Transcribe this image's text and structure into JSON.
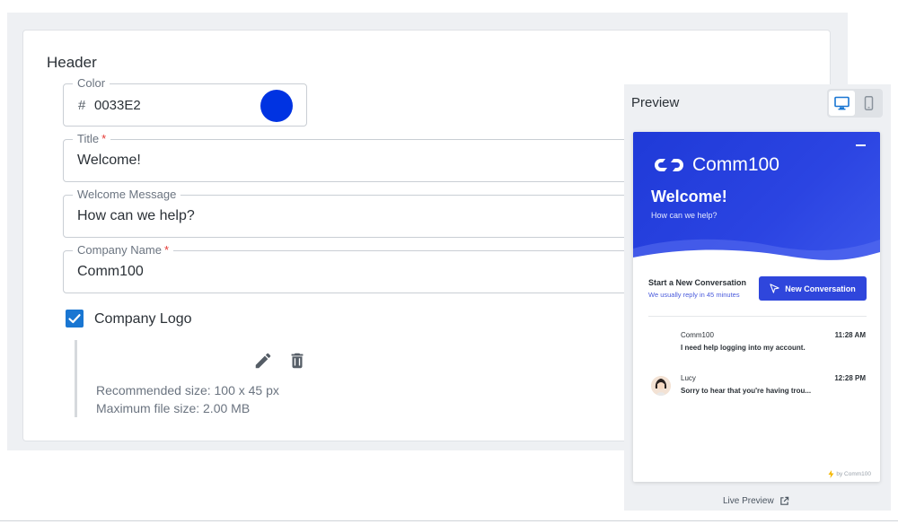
{
  "header": {
    "section_title": "Header"
  },
  "color_field": {
    "label": "Color",
    "hash": "#",
    "value": "0033E2",
    "swatch_color": "#0033E2"
  },
  "title_field": {
    "label": "Title",
    "required_mark": "*",
    "value": "Welcome!"
  },
  "welcome_field": {
    "label": "Welcome Message",
    "value": "How can we help?"
  },
  "company_field": {
    "label": "Company Name",
    "required_mark": "*",
    "value": "Comm100"
  },
  "company_logo": {
    "checkbox_label": "Company Logo",
    "checked": true,
    "edit_icon": "pencil-icon",
    "delete_icon": "trash-icon",
    "recommended": "Recommended size: 100 x 45 px",
    "max_size": "Maximum file size: 2.00 MB"
  },
  "preview": {
    "title": "Preview",
    "devices": [
      "desktop-icon",
      "mobile-icon"
    ],
    "selected_device": "desktop",
    "live_preview_label": "Live Preview",
    "widget": {
      "brand": "Comm100",
      "title": "Welcome!",
      "subtitle": "How can we help?",
      "start_title": "Start a New Conversation",
      "start_sub": "We usually reply in 45 minutes",
      "new_conversation_label": "New Conversation",
      "messages": [
        {
          "name": "Comm100",
          "time": "11:28 AM",
          "text": "I need help logging into my account."
        },
        {
          "name": "Lucy",
          "time": "12:28 PM",
          "text": "Sorry to hear that you're having trou..."
        }
      ],
      "powered_by": "by Comm100",
      "accent_color": "#2f46dc"
    }
  }
}
